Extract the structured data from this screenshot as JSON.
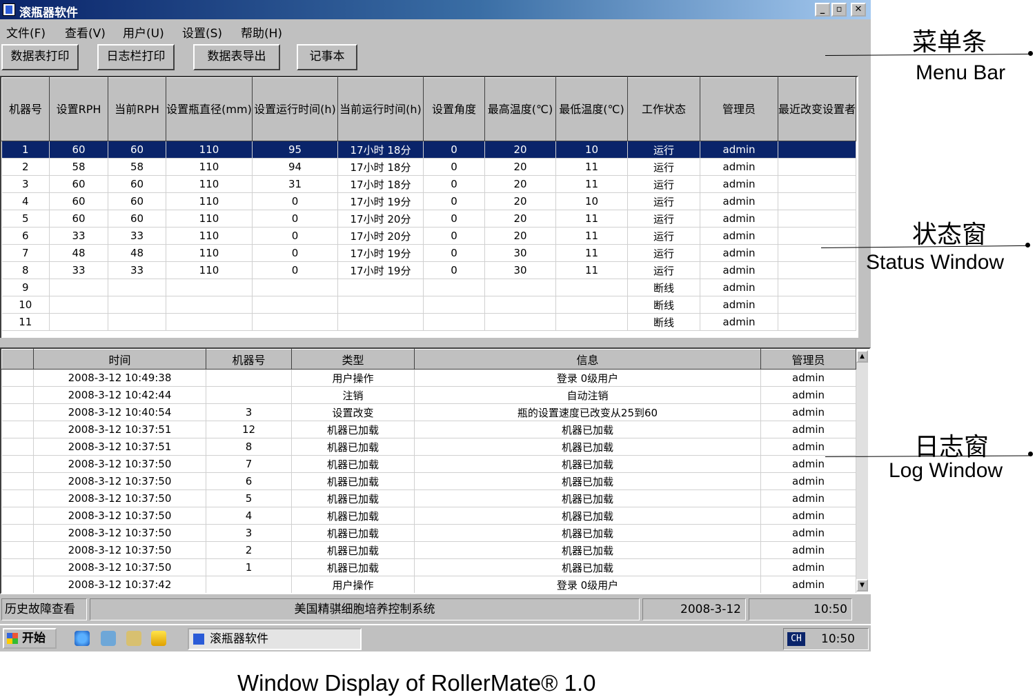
{
  "window": {
    "title": "滚瓶器软件"
  },
  "menu": [
    "文件(F)",
    "查看(V)",
    "用户(U)",
    "设置(S)",
    "帮助(H)"
  ],
  "toolbar": [
    "数据表打印",
    "日志栏打印",
    "数据表导出",
    "记事本"
  ],
  "status_table": {
    "columns": [
      "机器号",
      "设置RPH",
      "当前RPH",
      "设置瓶直径(mm)",
      "设置运行时间(h)",
      "当前运行时间(h)",
      "设置角度",
      "最高温度(℃)",
      "最低温度(℃)",
      "工作状态",
      "管理员",
      "最近改变设置者"
    ],
    "rows": [
      [
        "1",
        "60",
        "60",
        "110",
        "95",
        "17小时 18分",
        "0",
        "20",
        "10",
        "运行",
        "admin",
        ""
      ],
      [
        "2",
        "58",
        "58",
        "110",
        "94",
        "17小时 18分",
        "0",
        "20",
        "11",
        "运行",
        "admin",
        ""
      ],
      [
        "3",
        "60",
        "60",
        "110",
        "31",
        "17小时 18分",
        "0",
        "20",
        "11",
        "运行",
        "admin",
        ""
      ],
      [
        "4",
        "60",
        "60",
        "110",
        "0",
        "17小时 19分",
        "0",
        "20",
        "10",
        "运行",
        "admin",
        ""
      ],
      [
        "5",
        "60",
        "60",
        "110",
        "0",
        "17小时 20分",
        "0",
        "20",
        "11",
        "运行",
        "admin",
        ""
      ],
      [
        "6",
        "33",
        "33",
        "110",
        "0",
        "17小时 20分",
        "0",
        "20",
        "11",
        "运行",
        "admin",
        ""
      ],
      [
        "7",
        "48",
        "48",
        "110",
        "0",
        "17小时 19分",
        "0",
        "30",
        "11",
        "运行",
        "admin",
        ""
      ],
      [
        "8",
        "33",
        "33",
        "110",
        "0",
        "17小时 19分",
        "0",
        "30",
        "11",
        "运行",
        "admin",
        ""
      ],
      [
        "9",
        "",
        "",
        "",
        "",
        "",
        "",
        "",
        "",
        "断线",
        "admin",
        ""
      ],
      [
        "10",
        "",
        "",
        "",
        "",
        "",
        "",
        "",
        "",
        "断线",
        "admin",
        ""
      ],
      [
        "11",
        "",
        "",
        "",
        "",
        "",
        "",
        "",
        "",
        "断线",
        "admin",
        ""
      ]
    ]
  },
  "log_table": {
    "columns": [
      "",
      "时间",
      "机器号",
      "类型",
      "信息",
      "管理员"
    ],
    "rows": [
      [
        "",
        "2008-3-12 10:49:38",
        "",
        "用户操作",
        "登录 0级用户",
        "admin"
      ],
      [
        "",
        "2008-3-12 10:42:44",
        "",
        "注销",
        "自动注销",
        "admin"
      ],
      [
        "",
        "2008-3-12 10:40:54",
        "3",
        "设置改变",
        "瓶的设置速度已改变从25到60",
        "admin"
      ],
      [
        "",
        "2008-3-12 10:37:51",
        "12",
        "机器已加载",
        "机器已加载",
        "admin"
      ],
      [
        "",
        "2008-3-12 10:37:51",
        "8",
        "机器已加载",
        "机器已加载",
        "admin"
      ],
      [
        "",
        "2008-3-12 10:37:50",
        "7",
        "机器已加载",
        "机器已加载",
        "admin"
      ],
      [
        "",
        "2008-3-12 10:37:50",
        "6",
        "机器已加载",
        "机器已加载",
        "admin"
      ],
      [
        "",
        "2008-3-12 10:37:50",
        "5",
        "机器已加载",
        "机器已加载",
        "admin"
      ],
      [
        "",
        "2008-3-12 10:37:50",
        "4",
        "机器已加载",
        "机器已加载",
        "admin"
      ],
      [
        "",
        "2008-3-12 10:37:50",
        "3",
        "机器已加载",
        "机器已加载",
        "admin"
      ],
      [
        "",
        "2008-3-12 10:37:50",
        "2",
        "机器已加载",
        "机器已加载",
        "admin"
      ],
      [
        "",
        "2008-3-12 10:37:50",
        "1",
        "机器已加载",
        "机器已加载",
        "admin"
      ],
      [
        "",
        "2008-3-12 10:37:42",
        "",
        "用户操作",
        "登录 0级用户",
        "admin"
      ]
    ]
  },
  "statusbar": {
    "left": "历史故障查看",
    "center": "美国精骐细胞培养控制系统",
    "date": "2008-3-12",
    "time": "10:50"
  },
  "taskbar": {
    "start": "开始",
    "task": "滚瓶器软件",
    "ime": "CH",
    "clock": "10:50"
  },
  "annotations": {
    "menu_zh": "菜单条",
    "menu_en": "Menu  Bar",
    "status_zh": "状态窗",
    "status_en": "Status  Window",
    "log_zh": "日志窗",
    "log_en": "Log  Window"
  },
  "caption": "Window Display of RollerMate® 1.0"
}
